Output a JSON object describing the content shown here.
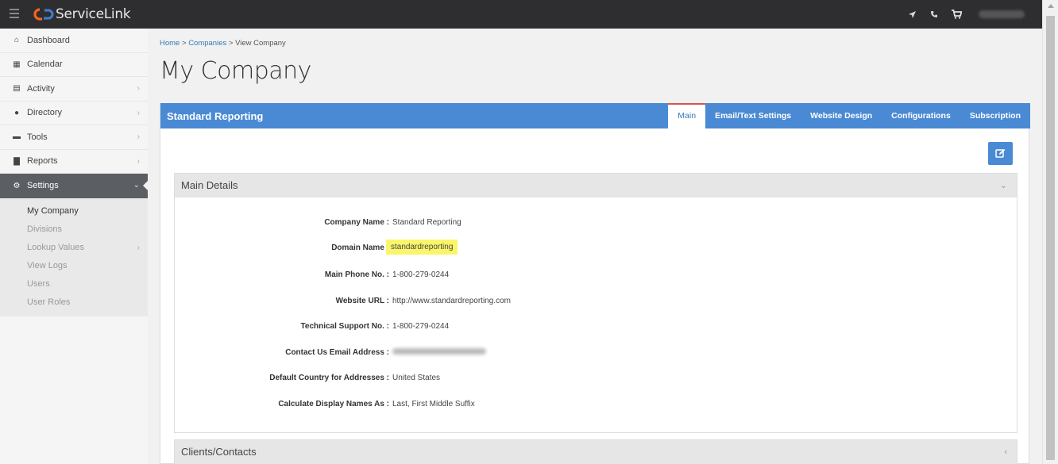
{
  "topbar": {
    "brand": "ServiceLink",
    "icons": [
      "location-arrow-icon",
      "phone-icon",
      "cart-icon"
    ],
    "user_name": ""
  },
  "sidebar": {
    "items": [
      {
        "label": "Dashboard",
        "icon": "home-icon",
        "has_children": false
      },
      {
        "label": "Calendar",
        "icon": "calendar-icon",
        "has_children": false
      },
      {
        "label": "Activity",
        "icon": "activity-icon",
        "has_children": true
      },
      {
        "label": "Directory",
        "icon": "users-icon",
        "has_children": true
      },
      {
        "label": "Tools",
        "icon": "toolbox-icon",
        "has_children": true
      },
      {
        "label": "Reports",
        "icon": "bar-chart-icon",
        "has_children": true
      },
      {
        "label": "Settings",
        "icon": "gear-icon",
        "has_children": true,
        "active": true
      }
    ],
    "settings_sub": [
      {
        "label": "My Company",
        "current": true
      },
      {
        "label": "Divisions"
      },
      {
        "label": "Lookup Values",
        "has_children": true
      },
      {
        "label": "View Logs"
      },
      {
        "label": "Users"
      },
      {
        "label": "User Roles"
      }
    ]
  },
  "breadcrumb": {
    "home": "Home",
    "sep": ">",
    "companies": "Companies",
    "current": "View Company"
  },
  "page_title": "My Company",
  "panel": {
    "title": "Standard Reporting",
    "tabs": [
      "Main",
      "Email/Text Settings",
      "Website Design",
      "Configurations",
      "Subscription"
    ],
    "active_tab": "Main"
  },
  "main_details": {
    "title": "Main Details",
    "fields": [
      {
        "label": "Company Name :",
        "value": "Standard Reporting"
      },
      {
        "label": "Domain Name :",
        "value": "standardreporting",
        "highlighted": true
      },
      {
        "label": "Main Phone No. :",
        "value": "1-800-279-0244"
      },
      {
        "label": "Website URL :",
        "value": "http://www.standardreporting.com"
      },
      {
        "label": "Technical Support No. :",
        "value": "1-800-279-0244"
      },
      {
        "label": "Contact Us Email Address :",
        "value": ""
      },
      {
        "label": "Default Country for Addresses :",
        "value": "United States"
      },
      {
        "label": "Calculate Display Names As :",
        "value": "Last, First Middle Suffix"
      }
    ]
  },
  "clients_section": {
    "title": "Clients/Contacts"
  },
  "colors": {
    "topbar": "#2e2e30",
    "accent": "#4a8ad4",
    "highlight": "#fbf56b",
    "active_tab_border": "#d9534f",
    "sidebar_active": "#5b5e63"
  }
}
